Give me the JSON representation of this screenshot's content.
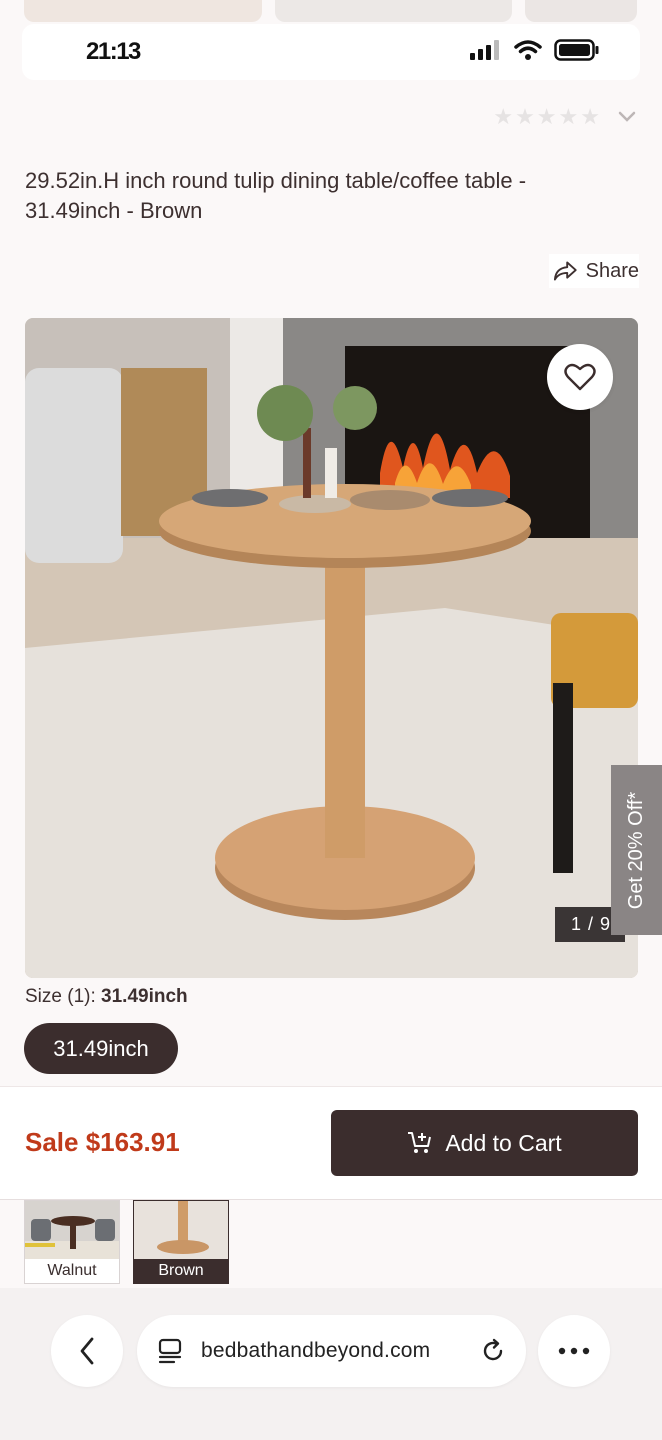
{
  "status_bar": {
    "time": "21:13"
  },
  "product": {
    "title": "29.52in.H inch round tulip dining table/coffee table - 31.49inch - Brown",
    "share_label": "Share",
    "image_counter": "1 / 9",
    "promo_tab": "Get 20% Off*"
  },
  "size": {
    "label_prefix": "Size (1): ",
    "selected": "31.49inch",
    "options": [
      "31.49inch"
    ]
  },
  "buy_bar": {
    "sale_label": "Sale $163.91",
    "add_to_cart": "Add to Cart"
  },
  "color_swatches": [
    {
      "label": "Walnut",
      "selected": false
    },
    {
      "label": "Brown",
      "selected": true
    }
  ],
  "browser": {
    "url": "bedbathandbeyond.com"
  },
  "colors": {
    "accent_dark": "#3b2d2d",
    "sale_red": "#c03a1a"
  },
  "icons": [
    "signal-icon",
    "wifi-icon",
    "battery-icon",
    "star-icon",
    "chevron-down-icon",
    "share-icon",
    "heart-icon",
    "cart-plus-icon",
    "back-icon",
    "page-icon",
    "reload-icon",
    "more-icon"
  ]
}
